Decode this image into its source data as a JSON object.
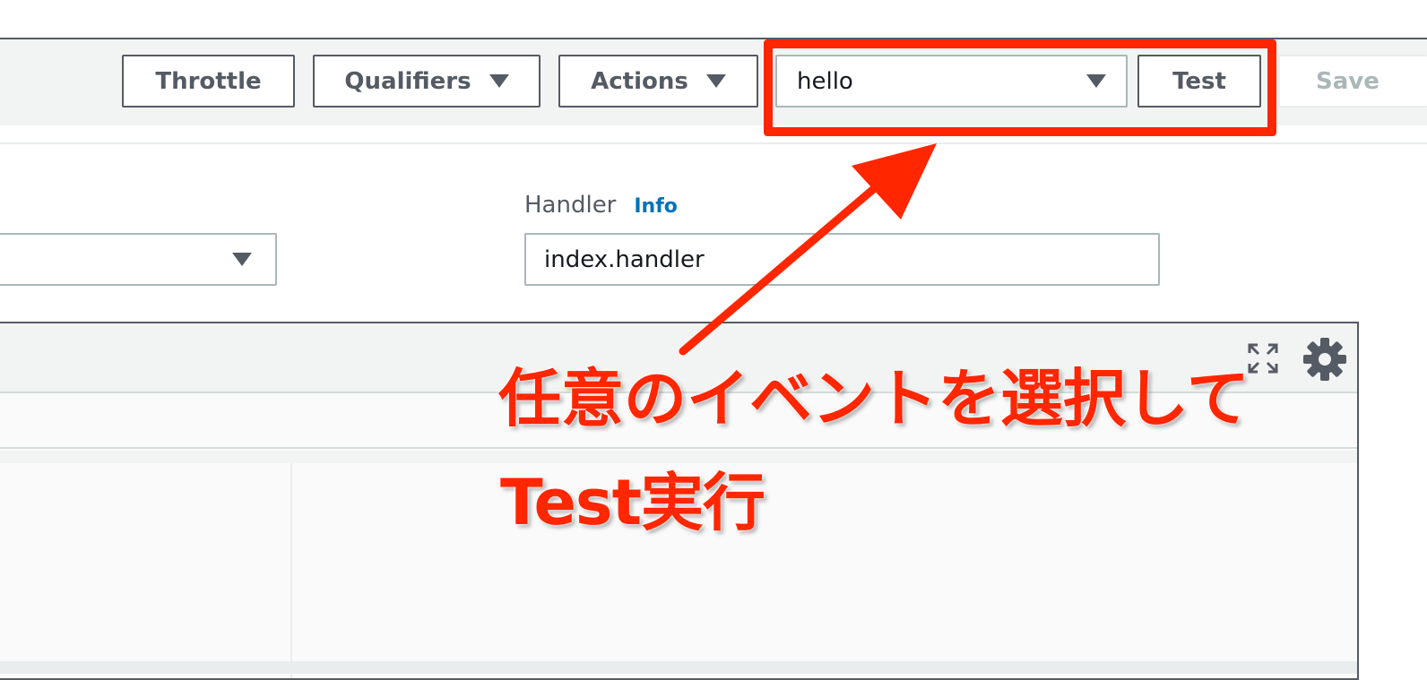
{
  "toolbar": {
    "throttle_label": "Throttle",
    "qualifiers_label": "Qualifiers",
    "actions_label": "Actions",
    "event_selected": "hello",
    "test_label": "Test",
    "save_label": "Save"
  },
  "form": {
    "handler_label": "Handler",
    "handler_info_link": "Info",
    "handler_value": "index.handler"
  },
  "annotation": {
    "line1": "任意のイベントを選択して",
    "line2": "Test実行"
  },
  "colors": {
    "annotation": "#ff2600",
    "link": "#0073bb",
    "button_border": "#545b64",
    "disabled_text": "#aab7b8"
  }
}
